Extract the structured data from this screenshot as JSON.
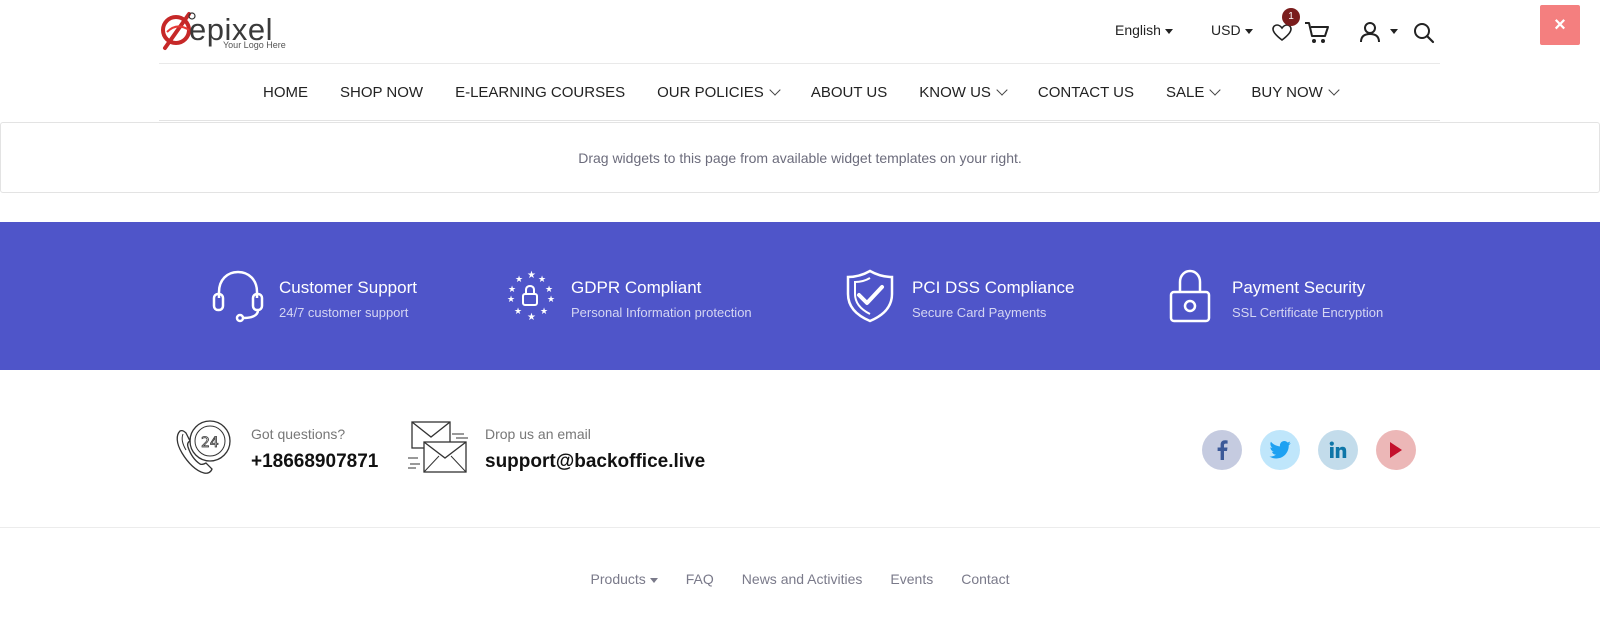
{
  "header": {
    "logo_text": "epixel",
    "logo_subtext": "Your Logo Here",
    "language": "English",
    "currency": "USD",
    "wishlist_count": "1"
  },
  "close_label": "×",
  "nav": {
    "items": [
      {
        "label": "HOME",
        "dropdown": false
      },
      {
        "label": "SHOP NOW",
        "dropdown": false
      },
      {
        "label": "E-LEARNING COURSES",
        "dropdown": false
      },
      {
        "label": "OUR POLICIES",
        "dropdown": true
      },
      {
        "label": "ABOUT US",
        "dropdown": false
      },
      {
        "label": "KNOW US",
        "dropdown": true
      },
      {
        "label": "CONTACT US",
        "dropdown": false
      },
      {
        "label": "SALE",
        "dropdown": true
      },
      {
        "label": "BUY NOW",
        "dropdown": true
      }
    ]
  },
  "widget_area": {
    "message": "Drag widgets to this page from available widget templates on your right."
  },
  "features": [
    {
      "icon": "headset-icon",
      "title": "Customer Support",
      "subtitle": "24/7 customer support"
    },
    {
      "icon": "gdpr-lock-icon",
      "title": "GDPR Compliant",
      "subtitle": "Personal Information protection"
    },
    {
      "icon": "shield-check-icon",
      "title": "PCI DSS Compliance",
      "subtitle": "Secure Card Payments"
    },
    {
      "icon": "padlock-icon",
      "title": "Payment Security",
      "subtitle": "SSL Certificate Encryption"
    }
  ],
  "contact": {
    "phone_label": "Got questions?",
    "phone": "+18668907871",
    "email_label": "Drop us an email",
    "email": "support@backoffice.live"
  },
  "social": [
    {
      "icon": "facebook-icon",
      "color": "#3b5998"
    },
    {
      "icon": "twitter-icon",
      "color": "#1da1f2"
    },
    {
      "icon": "linkedin-icon",
      "color": "#0e76a8"
    },
    {
      "icon": "youtube-icon",
      "color": "#c4302b"
    }
  ],
  "footer_links": [
    {
      "label": "Products",
      "dropdown": true
    },
    {
      "label": "FAQ",
      "dropdown": false
    },
    {
      "label": "News and Activities",
      "dropdown": false
    },
    {
      "label": "Events",
      "dropdown": false
    },
    {
      "label": "Contact",
      "dropdown": false
    }
  ],
  "colors": {
    "band_background": "#4f55c9",
    "close_button": "#f47f7f",
    "badge": "#7a1d1d"
  }
}
